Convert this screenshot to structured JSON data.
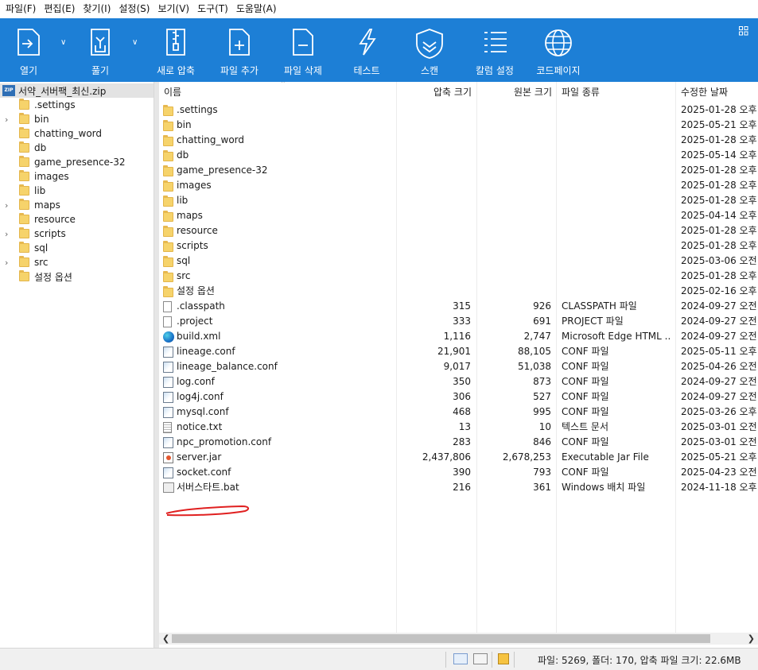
{
  "menu": [
    "파일(F)",
    "편집(E)",
    "찾기(I)",
    "설정(S)",
    "보기(V)",
    "도구(T)",
    "도움말(A)"
  ],
  "toolbar": {
    "open": "열기",
    "extract": "풀기",
    "new_archive": "새로 압축",
    "add_file": "파일 추가",
    "delete_file": "파일 삭제",
    "test": "테스트",
    "scan": "스캔",
    "column_settings": "칼럼 설정",
    "codepage": "코드페이지"
  },
  "tree": {
    "root": "서약_서버팩_최신.zip",
    "items": [
      {
        "label": ".settings",
        "expandable": false
      },
      {
        "label": "bin",
        "expandable": true
      },
      {
        "label": "chatting_word",
        "expandable": false
      },
      {
        "label": "db",
        "expandable": false
      },
      {
        "label": "game_presence-32",
        "expandable": false
      },
      {
        "label": "images",
        "expandable": false
      },
      {
        "label": "lib",
        "expandable": false
      },
      {
        "label": "maps",
        "expandable": true
      },
      {
        "label": "resource",
        "expandable": false
      },
      {
        "label": "scripts",
        "expandable": true
      },
      {
        "label": "sql",
        "expandable": false
      },
      {
        "label": "src",
        "expandable": true
      },
      {
        "label": "설정 옵션",
        "expandable": false
      }
    ]
  },
  "columns": {
    "name": "이름",
    "compressed": "압축 크기",
    "original": "원본 크기",
    "type": "파일 종류",
    "modified": "수정한 날짜"
  },
  "files": [
    {
      "icon": "folder",
      "name": ".settings",
      "compressed": "",
      "original": "",
      "type": "",
      "modified": "2025-01-28 오후"
    },
    {
      "icon": "folder",
      "name": "bin",
      "compressed": "",
      "original": "",
      "type": "",
      "modified": "2025-05-21 오후"
    },
    {
      "icon": "folder",
      "name": "chatting_word",
      "compressed": "",
      "original": "",
      "type": "",
      "modified": "2025-01-28 오후"
    },
    {
      "icon": "folder",
      "name": "db",
      "compressed": "",
      "original": "",
      "type": "",
      "modified": "2025-05-14 오후"
    },
    {
      "icon": "folder",
      "name": "game_presence-32",
      "compressed": "",
      "original": "",
      "type": "",
      "modified": "2025-01-28 오후"
    },
    {
      "icon": "folder",
      "name": "images",
      "compressed": "",
      "original": "",
      "type": "",
      "modified": "2025-01-28 오후"
    },
    {
      "icon": "folder",
      "name": "lib",
      "compressed": "",
      "original": "",
      "type": "",
      "modified": "2025-01-28 오후"
    },
    {
      "icon": "folder",
      "name": "maps",
      "compressed": "",
      "original": "",
      "type": "",
      "modified": "2025-04-14 오후"
    },
    {
      "icon": "folder",
      "name": "resource",
      "compressed": "",
      "original": "",
      "type": "",
      "modified": "2025-01-28 오후"
    },
    {
      "icon": "folder",
      "name": "scripts",
      "compressed": "",
      "original": "",
      "type": "",
      "modified": "2025-01-28 오후"
    },
    {
      "icon": "folder",
      "name": "sql",
      "compressed": "",
      "original": "",
      "type": "",
      "modified": "2025-03-06 오전"
    },
    {
      "icon": "folder",
      "name": "src",
      "compressed": "",
      "original": "",
      "type": "",
      "modified": "2025-01-28 오후"
    },
    {
      "icon": "folder",
      "name": "설정 옵션",
      "compressed": "",
      "original": "",
      "type": "",
      "modified": "2025-02-16 오후"
    },
    {
      "icon": "file",
      "name": ".classpath",
      "compressed": "315",
      "original": "926",
      "type": "CLASSPATH 파일",
      "modified": "2024-09-27 오전"
    },
    {
      "icon": "file",
      "name": ".project",
      "compressed": "333",
      "original": "691",
      "type": "PROJECT 파일",
      "modified": "2024-09-27 오전"
    },
    {
      "icon": "edge",
      "name": "build.xml",
      "compressed": "1,116",
      "original": "2,747",
      "type": "Microsoft Edge HTML ...",
      "modified": "2024-09-27 오전"
    },
    {
      "icon": "conf",
      "name": "lineage.conf",
      "compressed": "21,901",
      "original": "88,105",
      "type": "CONF 파일",
      "modified": "2025-05-11 오후"
    },
    {
      "icon": "conf",
      "name": "lineage_balance.conf",
      "compressed": "9,017",
      "original": "51,038",
      "type": "CONF 파일",
      "modified": "2025-04-26 오전"
    },
    {
      "icon": "conf",
      "name": "log.conf",
      "compressed": "350",
      "original": "873",
      "type": "CONF 파일",
      "modified": "2024-09-27 오전"
    },
    {
      "icon": "conf",
      "name": "log4j.conf",
      "compressed": "306",
      "original": "527",
      "type": "CONF 파일",
      "modified": "2024-09-27 오전"
    },
    {
      "icon": "conf",
      "name": "mysql.conf",
      "compressed": "468",
      "original": "995",
      "type": "CONF 파일",
      "modified": "2025-03-26 오후"
    },
    {
      "icon": "txt",
      "name": "notice.txt",
      "compressed": "13",
      "original": "10",
      "type": "텍스트 문서",
      "modified": "2025-03-01 오전"
    },
    {
      "icon": "conf",
      "name": "npc_promotion.conf",
      "compressed": "283",
      "original": "846",
      "type": "CONF 파일",
      "modified": "2025-03-01 오전"
    },
    {
      "icon": "jar",
      "name": "server.jar",
      "compressed": "2,437,806",
      "original": "2,678,253",
      "type": "Executable Jar File",
      "modified": "2025-05-21 오후"
    },
    {
      "icon": "conf",
      "name": "socket.conf",
      "compressed": "390",
      "original": "793",
      "type": "CONF 파일",
      "modified": "2025-04-23 오전"
    },
    {
      "icon": "bat",
      "name": "서버스타트.bat",
      "compressed": "216",
      "original": "361",
      "type": "Windows 배치 파일",
      "modified": "2024-11-18 오후"
    }
  ],
  "status": {
    "summary": "파일: 5269, 폴더: 170, 압축 파일 크기: 22.6MB"
  },
  "colors": {
    "toolbar_bg": "#1d7fd6",
    "annotation": "#e02020"
  }
}
